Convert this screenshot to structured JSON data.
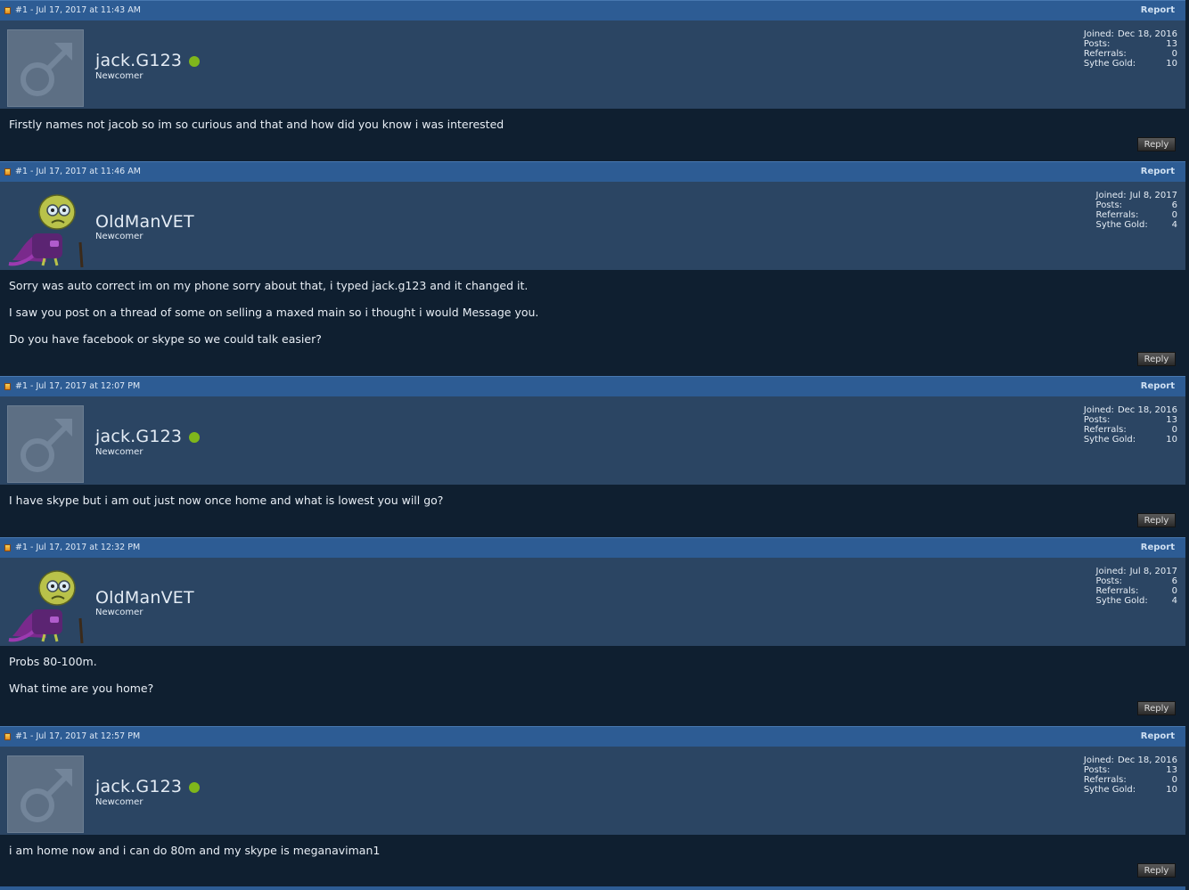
{
  "colors": {
    "header_bar": "#2d5c94",
    "user_bar": "#2b4563",
    "body_bg": "#0f1f30",
    "online": "#7fb61b"
  },
  "posts": [
    {
      "meta": "#1 - Jul 17, 2017 at 11:43 AM",
      "report": "Report",
      "username": "jack.G123",
      "online": true,
      "avatar": "default-male-avatar",
      "usertitle": "Newcomer",
      "stats": {
        "joined_label": "Joined:",
        "joined": "Dec 18, 2016",
        "posts_label": "Posts:",
        "posts": "13",
        "referrals_label": "Referrals:",
        "referrals": "0",
        "gold_label": "Sythe Gold:",
        "gold": "10"
      },
      "lines": [
        "Firstly names not jacob so im so curious and that and how did you know i was interested"
      ],
      "reply": "Reply"
    },
    {
      "meta": "#1 - Jul 17, 2017 at 11:46 AM",
      "report": "Report",
      "username": "OldManVET",
      "online": false,
      "avatar": "old-man-character-avatar",
      "usertitle": "Newcomer",
      "stats": {
        "joined_label": "Joined:",
        "joined": "Jul 8, 2017",
        "posts_label": "Posts:",
        "posts": "6",
        "referrals_label": "Referrals:",
        "referrals": "0",
        "gold_label": "Sythe Gold:",
        "gold": "4"
      },
      "lines": [
        "Sorry was auto correct im on my phone sorry about that, i typed jack.g123 and it changed it.",
        "I saw you post on a thread of some on selling a maxed main so i thought i would Message you.",
        "Do you have facebook or skype so we could talk easier?"
      ],
      "reply": "Reply"
    },
    {
      "meta": "#1 - Jul 17, 2017 at 12:07 PM",
      "report": "Report",
      "username": "jack.G123",
      "online": true,
      "avatar": "default-male-avatar",
      "usertitle": "Newcomer",
      "stats": {
        "joined_label": "Joined:",
        "joined": "Dec 18, 2016",
        "posts_label": "Posts:",
        "posts": "13",
        "referrals_label": "Referrals:",
        "referrals": "0",
        "gold_label": "Sythe Gold:",
        "gold": "10"
      },
      "lines": [
        "I have skype but i am out just now once home and what is lowest you will go?"
      ],
      "reply": "Reply"
    },
    {
      "meta": "#1 - Jul 17, 2017 at 12:32 PM",
      "report": "Report",
      "username": "OldManVET",
      "online": false,
      "avatar": "old-man-character-avatar",
      "usertitle": "Newcomer",
      "stats": {
        "joined_label": "Joined:",
        "joined": "Jul 8, 2017",
        "posts_label": "Posts:",
        "posts": "6",
        "referrals_label": "Referrals:",
        "referrals": "0",
        "gold_label": "Sythe Gold:",
        "gold": "4"
      },
      "lines": [
        "Probs 80-100m.",
        "What time are you home?"
      ],
      "reply": "Reply"
    },
    {
      "meta": "#1 - Jul 17, 2017 at 12:57 PM",
      "report": "Report",
      "username": "jack.G123",
      "online": true,
      "avatar": "default-male-avatar",
      "usertitle": "Newcomer",
      "stats": {
        "joined_label": "Joined:",
        "joined": "Dec 18, 2016",
        "posts_label": "Posts:",
        "posts": "13",
        "referrals_label": "Referrals:",
        "referrals": "0",
        "gold_label": "Sythe Gold:",
        "gold": "10"
      },
      "lines": [
        "i am home now and i can do 80m and my skype is meganaviman1"
      ],
      "reply": "Reply"
    }
  ]
}
